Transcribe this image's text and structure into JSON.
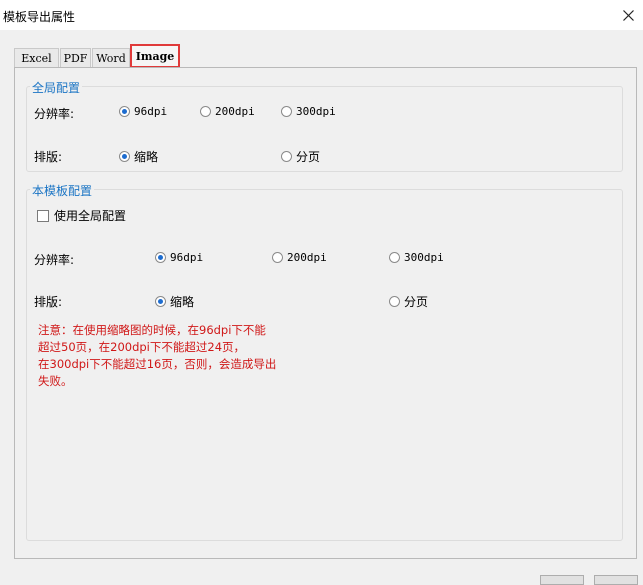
{
  "window": {
    "title": "模板导出属性"
  },
  "tabs": [
    {
      "label": "Excel"
    },
    {
      "label": "PDF"
    },
    {
      "label": "Word"
    },
    {
      "label": "Image"
    }
  ],
  "global_section": {
    "title": "全局配置",
    "resolution_label": "分辨率:",
    "resolution_options": [
      "96dpi",
      "200dpi",
      "300dpi"
    ],
    "resolution_selected": "96dpi",
    "layout_label": "排版:",
    "layout_options": [
      "缩略",
      "分页"
    ],
    "layout_selected": "缩略"
  },
  "template_section": {
    "title": "本模板配置",
    "use_global_label": "使用全局配置",
    "use_global_checked": false,
    "resolution_label": "分辨率:",
    "resolution_options": [
      "96dpi",
      "200dpi",
      "300dpi"
    ],
    "resolution_selected": "96dpi",
    "layout_label": "排版:",
    "layout_options": [
      "缩略",
      "分页"
    ],
    "layout_selected": "缩略"
  },
  "note": {
    "lines": [
      "注意：在使用缩略图的时候，在96dpi下不能",
      "超过50页，在200dpi下不能超过24页，",
      "在300dpi下不能超过16页，否则，会造成导出",
      "失败。"
    ]
  },
  "colors": {
    "section_title": "#1a74c4",
    "note_text": "#d01818",
    "active_tab_outline": "#e03a3a",
    "radio_selected": "#1d6ccf"
  }
}
